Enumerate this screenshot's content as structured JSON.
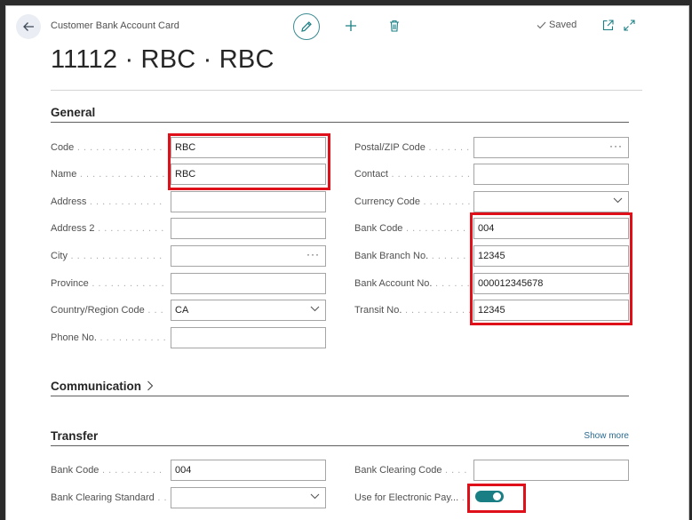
{
  "header": {
    "caption": "Customer Bank Account Card",
    "title": "11112 · RBC · RBC",
    "saved_label": "Saved"
  },
  "general": {
    "heading": "General",
    "left_fields": [
      {
        "label": "Code",
        "value": "RBC"
      },
      {
        "label": "Name",
        "value": "RBC"
      },
      {
        "label": "Address",
        "value": ""
      },
      {
        "label": "Address 2",
        "value": ""
      },
      {
        "label": "City",
        "value": ""
      },
      {
        "label": "Province",
        "value": ""
      },
      {
        "label": "Country/Region Code",
        "value": "CA"
      },
      {
        "label": "Phone No.",
        "value": ""
      }
    ],
    "right_fields": [
      {
        "label": "Postal/ZIP Code",
        "value": ""
      },
      {
        "label": "Contact",
        "value": ""
      },
      {
        "label": "Currency Code",
        "value": ""
      },
      {
        "label": "Bank Code",
        "value": "004"
      },
      {
        "label": "Bank Branch No.",
        "value": "12345"
      },
      {
        "label": "Bank Account No.",
        "value": "000012345678"
      },
      {
        "label": "Transit No.",
        "value": "12345"
      }
    ]
  },
  "communication": {
    "heading": "Communication"
  },
  "transfer": {
    "heading": "Transfer",
    "show_more": "Show more",
    "bank_code_label": "Bank Code",
    "bank_code_value": "004",
    "bank_clearing_standard_label": "Bank Clearing Standard",
    "bank_clearing_standard_value": "",
    "bank_clearing_code_label": "Bank Clearing Code",
    "bank_clearing_code_value": "",
    "use_electronic_label": "Use for Electronic Pay...",
    "use_electronic_on": true
  },
  "colors": {
    "accent": "#1a7f84",
    "highlight": "#e0101a"
  }
}
